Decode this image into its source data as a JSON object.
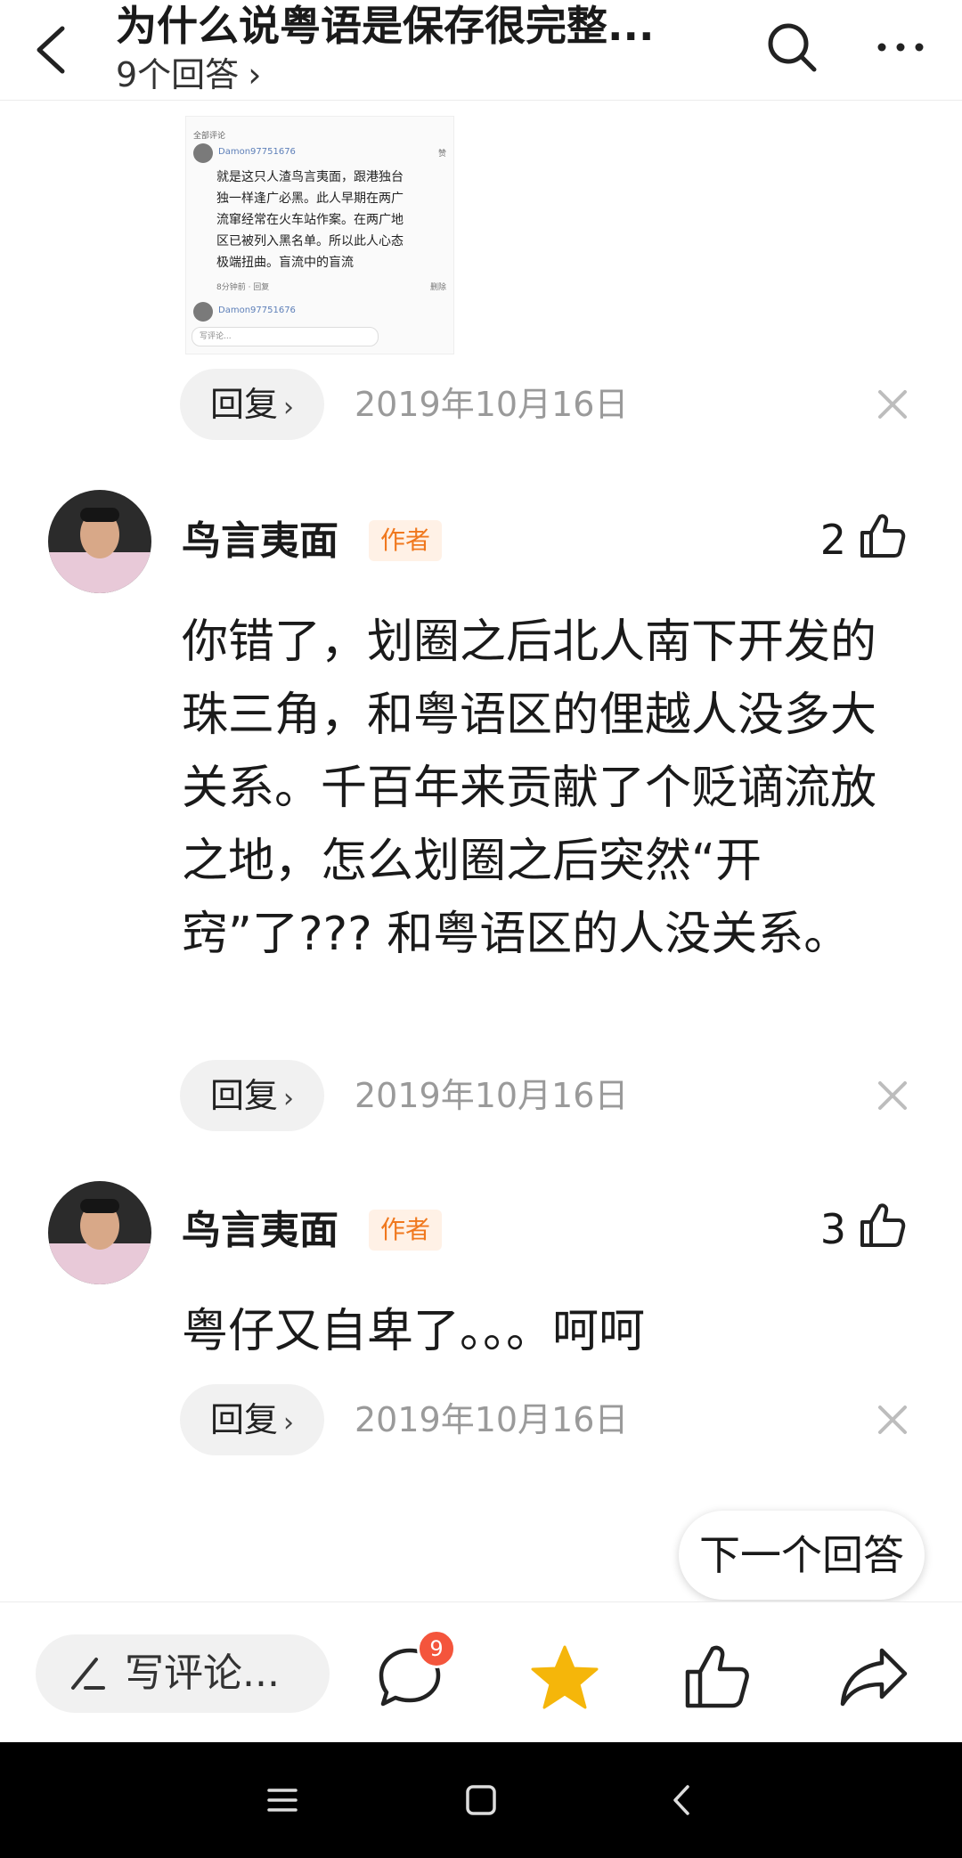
{
  "header": {
    "title": "为什么说粤语是保存很完整...",
    "subtitle": "9个回答",
    "subtitle_chevron": "›"
  },
  "embedded_screenshot": {
    "section_label": "全部评论",
    "username_1": "Damon97751676",
    "like_label": "赞",
    "body": "就是这只人渣鸟言夷面，跟港独台独一样逢广必黑。此人早期在两广流窜经常在火车站作案。在两广地区已被列入黑名单。所以此人心态极端扭曲。盲流中的盲流",
    "meta": "8分钟前 · 回复",
    "delete_label": "删除",
    "username_2": "Damon97751676",
    "input_placeholder": "写评论..."
  },
  "reply_label": "回复",
  "reply_chevron": "›",
  "comments": [
    {
      "username": "鸟言夷面",
      "badge": "作者",
      "likes": "2",
      "content": "你错了，划圈之后北人南下开发的珠三角，和粤语区的俚越人没多大关系。千百年来贡献了个贬谪流放之地，怎么划圈之后突然“开窍”了??? 和粤语区的人没关系。",
      "date": "2019年10月16日"
    },
    {
      "username": "鸟言夷面",
      "badge": "作者",
      "likes": "3",
      "content": "粤仔又自卑了。。。呵呵",
      "date": "2019年10月16日"
    }
  ],
  "first_reply_date": "2019年10月16日",
  "next_answer_label": "下一个回答",
  "bottom_bar": {
    "write_placeholder": "写评论...",
    "comment_count": "9"
  },
  "colors": {
    "author_badge_bg": "#fff1e6",
    "author_badge_text": "#f0781e",
    "star": "#f5b60a",
    "notification_badge": "#f4553c"
  },
  "icons": [
    "back-icon",
    "search-icon",
    "more-icon",
    "close-icon",
    "thumbs-up-icon",
    "pen-icon",
    "comment-icon",
    "star-icon",
    "share-icon",
    "menu-icon",
    "home-icon",
    "nav-back-icon"
  ]
}
